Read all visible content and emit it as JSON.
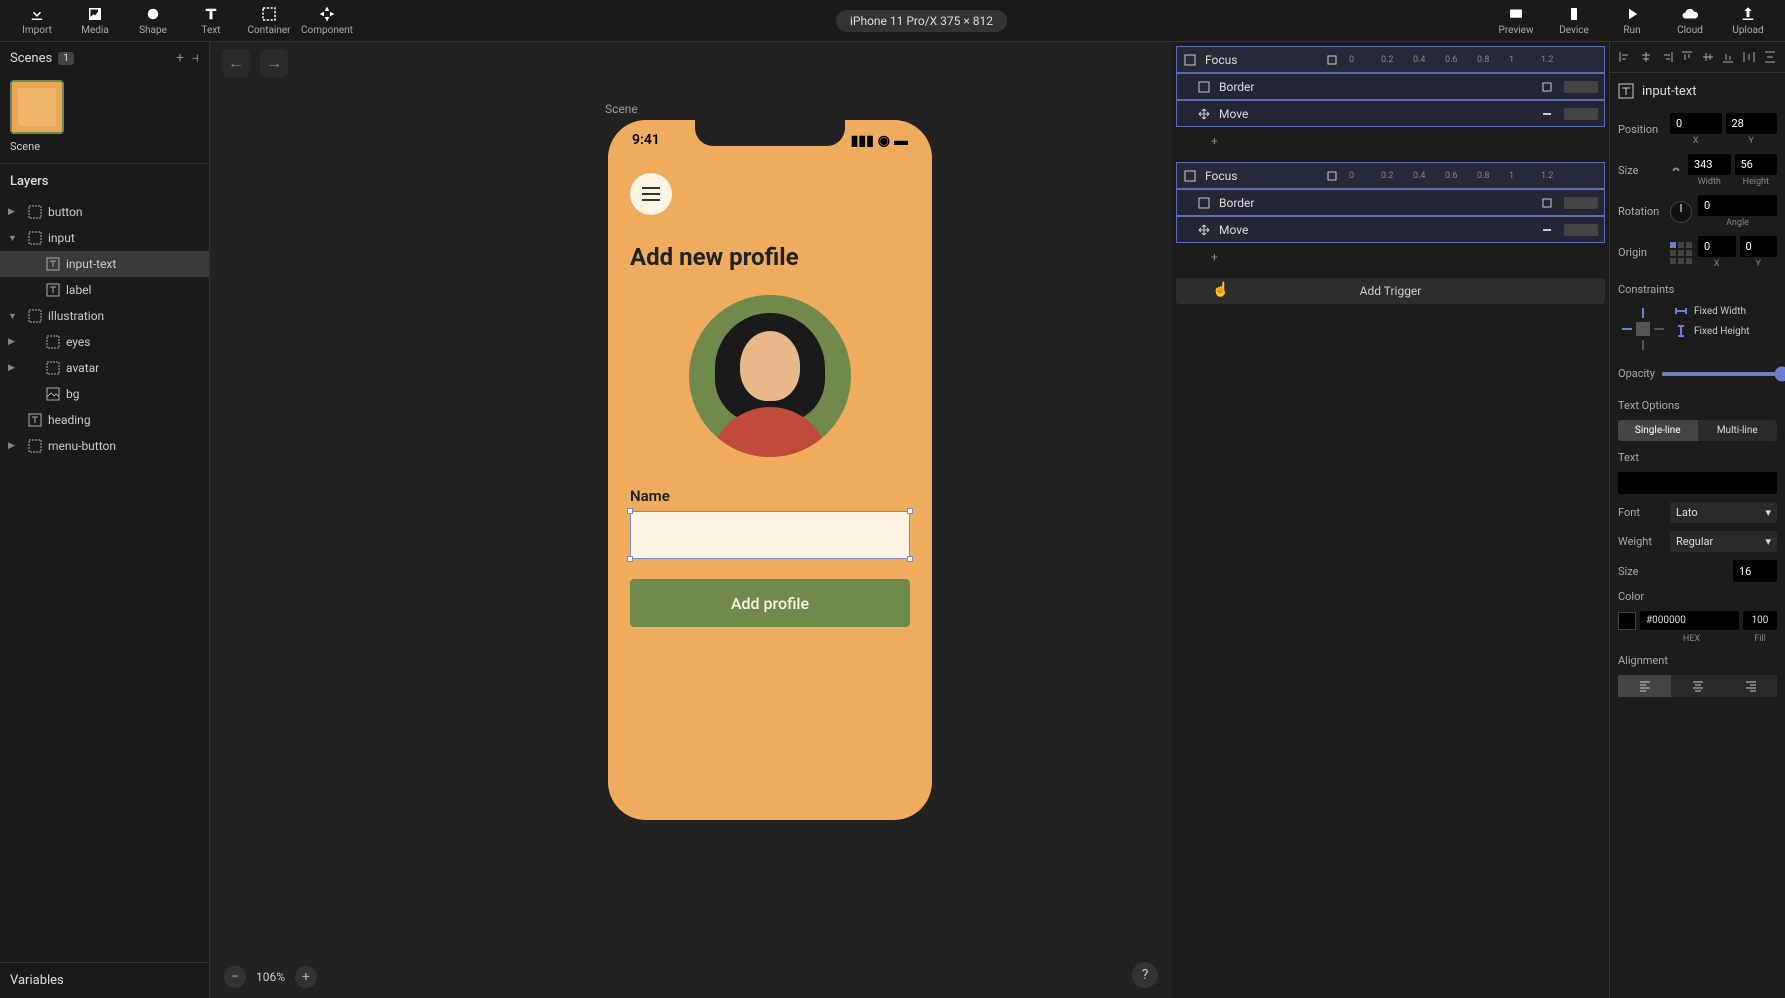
{
  "toolbar": {
    "left": [
      {
        "name": "import",
        "label": "Import"
      },
      {
        "name": "media",
        "label": "Media"
      },
      {
        "name": "shape",
        "label": "Shape"
      },
      {
        "name": "text",
        "label": "Text"
      },
      {
        "name": "container",
        "label": "Container"
      },
      {
        "name": "component",
        "label": "Component"
      }
    ],
    "device_label": "iPhone 11 Pro/X  375 × 812",
    "right": [
      {
        "name": "preview",
        "label": "Preview"
      },
      {
        "name": "device",
        "label": "Device"
      },
      {
        "name": "run",
        "label": "Run"
      },
      {
        "name": "cloud",
        "label": "Cloud"
      },
      {
        "name": "upload",
        "label": "Upload"
      }
    ]
  },
  "scenes": {
    "title": "Scenes",
    "count": "1",
    "thumb_label": "Scene"
  },
  "layers": {
    "title": "Layers",
    "items": [
      {
        "name": "button",
        "indent": 0,
        "caret": "▶",
        "icon": "container"
      },
      {
        "name": "input",
        "indent": 0,
        "caret": "▼",
        "icon": "container"
      },
      {
        "name": "input-text",
        "indent": 1,
        "caret": "",
        "icon": "text",
        "selected": true
      },
      {
        "name": "label",
        "indent": 1,
        "caret": "",
        "icon": "text"
      },
      {
        "name": "illustration",
        "indent": 0,
        "caret": "▼",
        "icon": "container"
      },
      {
        "name": "eyes",
        "indent": 1,
        "caret": "▶",
        "icon": "container"
      },
      {
        "name": "avatar",
        "indent": 1,
        "caret": "▶",
        "icon": "container"
      },
      {
        "name": "bg",
        "indent": 1,
        "caret": "",
        "icon": "image"
      },
      {
        "name": "heading",
        "indent": 0,
        "caret": "",
        "icon": "text"
      },
      {
        "name": "menu-button",
        "indent": 0,
        "caret": "▶",
        "icon": "container"
      }
    ]
  },
  "variables": {
    "title": "Variables"
  },
  "canvas": {
    "scene_label": "Scene",
    "zoom": "106%",
    "artboard": {
      "time": "9:41",
      "heading": "Add new profile",
      "field_label": "Name",
      "button_label": "Add profile"
    }
  },
  "triggers": {
    "groups": [
      {
        "title": "Focus",
        "ticks": [
          "0",
          "0.2",
          "0.4",
          "0.6",
          "0.8",
          "1",
          "1.2"
        ],
        "actions": [
          {
            "label": "Border",
            "icon": "border",
            "bar": 34,
            "right": "kf"
          },
          {
            "label": "Move",
            "icon": "move",
            "bar": 34,
            "right": "minus"
          }
        ]
      },
      {
        "title": "Focus",
        "ticks": [
          "0",
          "0.2",
          "0.4",
          "0.6",
          "0.8",
          "1",
          "1.2"
        ],
        "actions": [
          {
            "label": "Border",
            "icon": "border",
            "bar": 34,
            "right": "kf"
          },
          {
            "label": "Move",
            "icon": "move",
            "bar": 34,
            "right": "minus"
          }
        ]
      }
    ],
    "add_label": "Add Trigger"
  },
  "inspector": {
    "element_name": "input-text",
    "position": {
      "x": "0",
      "y": "28",
      "xlabel": "X",
      "ylabel": "Y"
    },
    "size": {
      "w": "343",
      "h": "56",
      "wlabel": "Width",
      "hlabel": "Height"
    },
    "rotation": {
      "value": "0",
      "label": "Angle"
    },
    "origin": {
      "x": "0",
      "y": "0",
      "xlabel": "X",
      "ylabel": "Y"
    },
    "labels": {
      "position": "Position",
      "size": "Size",
      "rotation": "Rotation",
      "origin": "Origin",
      "constraints": "Constraints",
      "fixed_width": "Fixed Width",
      "fixed_height": "Fixed Height",
      "opacity": "Opacity",
      "text_options": "Text Options",
      "single_line": "Single-line",
      "multi_line": "Multi-line",
      "text": "Text",
      "font": "Font",
      "weight": "Weight",
      "font_size": "Size",
      "color": "Color",
      "hex": "HEX",
      "fill": "Fill",
      "alignment": "Alignment"
    },
    "opacity": "100",
    "font": "Lato",
    "weight": "Regular",
    "font_size": "16",
    "color_hex": "#000000",
    "color_fill": "100"
  }
}
